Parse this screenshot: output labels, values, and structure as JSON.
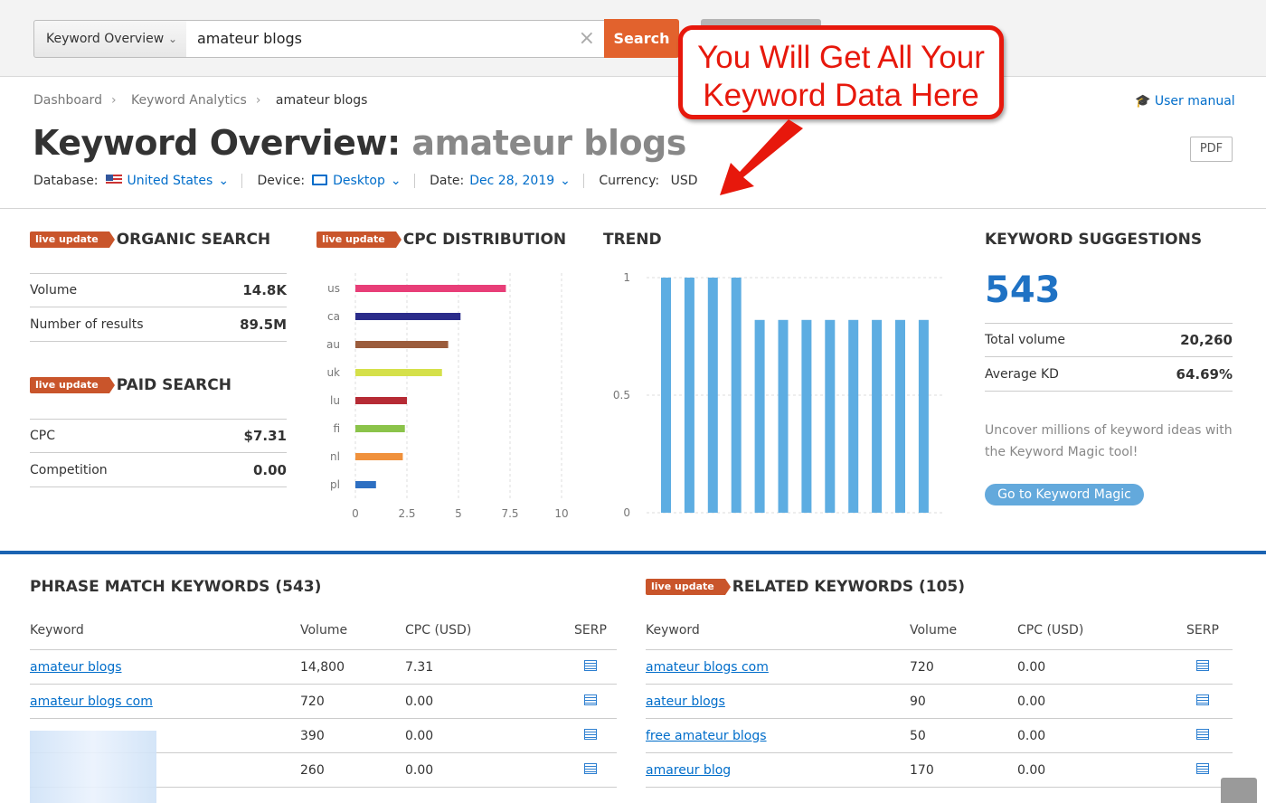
{
  "search": {
    "db_label": "Keyword Overview",
    "query": "amateur blogs",
    "search_label": "Search"
  },
  "breadcrumb": [
    "Dashboard",
    "Keyword Analytics",
    "amateur blogs"
  ],
  "user_manual": "User manual",
  "title": {
    "prefix": "Keyword Overview:",
    "keyword": "amateur blogs"
  },
  "pdf_label": "PDF",
  "filters": {
    "database_label": "Database:",
    "database_value": "United States",
    "device_label": "Device:",
    "device_value": "Desktop",
    "date_label": "Date:",
    "date_value": "Dec 28, 2019",
    "currency_label": "Currency:",
    "currency_value": "USD"
  },
  "badge": "live update",
  "organic": {
    "title": "ORGANIC SEARCH",
    "rows": [
      {
        "label": "Volume",
        "value": "14.8K"
      },
      {
        "label": "Number of results",
        "value": "89.5M"
      }
    ]
  },
  "paid": {
    "title": "PAID SEARCH",
    "rows": [
      {
        "label": "CPC",
        "value": "$7.31"
      },
      {
        "label": "Competition",
        "value": "0.00"
      }
    ]
  },
  "cpc_title": "CPC DISTRIBUTION",
  "trend_title": "TREND",
  "chart_data": [
    {
      "type": "bar",
      "orientation": "horizontal",
      "title": "CPC DISTRIBUTION",
      "categories": [
        "us",
        "ca",
        "au",
        "uk",
        "lu",
        "fi",
        "nl",
        "pl"
      ],
      "values": [
        7.3,
        5.1,
        4.5,
        4.2,
        2.5,
        2.4,
        2.3,
        1.0
      ],
      "colors": [
        "#e83e78",
        "#2b2c8a",
        "#9b5c3c",
        "#d5e04a",
        "#b62b35",
        "#8bc34a",
        "#f0913c",
        "#2d6fc2"
      ],
      "xlim": [
        0,
        10
      ],
      "xticks": [
        "0",
        "2.5",
        "5",
        "7.5",
        "10"
      ]
    },
    {
      "type": "bar",
      "title": "TREND",
      "values": [
        1,
        1,
        1,
        1,
        0.82,
        0.82,
        0.82,
        0.82,
        0.82,
        0.82,
        0.82,
        0.82
      ],
      "ylim": [
        0,
        1
      ],
      "yticks": [
        "0",
        "0.5",
        "1"
      ],
      "color": "#5dade2"
    }
  ],
  "suggestions": {
    "title": "KEYWORD SUGGESTIONS",
    "count": "543",
    "rows": [
      {
        "label": "Total volume",
        "value": "20,260"
      },
      {
        "label": "Average KD",
        "value": "64.69%"
      }
    ],
    "text": "Uncover millions of keyword ideas with the Keyword Magic tool!",
    "button": "Go to Keyword Magic"
  },
  "phrase": {
    "title": "PHRASE MATCH KEYWORDS (543)",
    "headers": [
      "Keyword",
      "Volume",
      "CPC (USD)",
      "SERP"
    ],
    "rows": [
      {
        "keyword": "amateur blogs",
        "volume": "14,800",
        "cpc": "7.31"
      },
      {
        "keyword": "amateur blogs com",
        "volume": "720",
        "cpc": "0.00"
      },
      {
        "keyword": "",
        "volume": "390",
        "cpc": "0.00"
      },
      {
        "keyword": "",
        "volume": "260",
        "cpc": "0.00"
      }
    ]
  },
  "related": {
    "title": "RELATED KEYWORDS (105)",
    "headers": [
      "Keyword",
      "Volume",
      "CPC (USD)",
      "SERP"
    ],
    "rows": [
      {
        "keyword": "amateur blogs com",
        "volume": "720",
        "cpc": "0.00"
      },
      {
        "keyword": "aateur blogs",
        "volume": "90",
        "cpc": "0.00"
      },
      {
        "keyword": "free amateur blogs",
        "volume": "50",
        "cpc": "0.00"
      },
      {
        "keyword": "amareur blog",
        "volume": "170",
        "cpc": "0.00"
      }
    ]
  },
  "callout": {
    "line1": "You Will Get All Your",
    "line2": "Keyword Data Here",
    "color": "#e7180c"
  }
}
